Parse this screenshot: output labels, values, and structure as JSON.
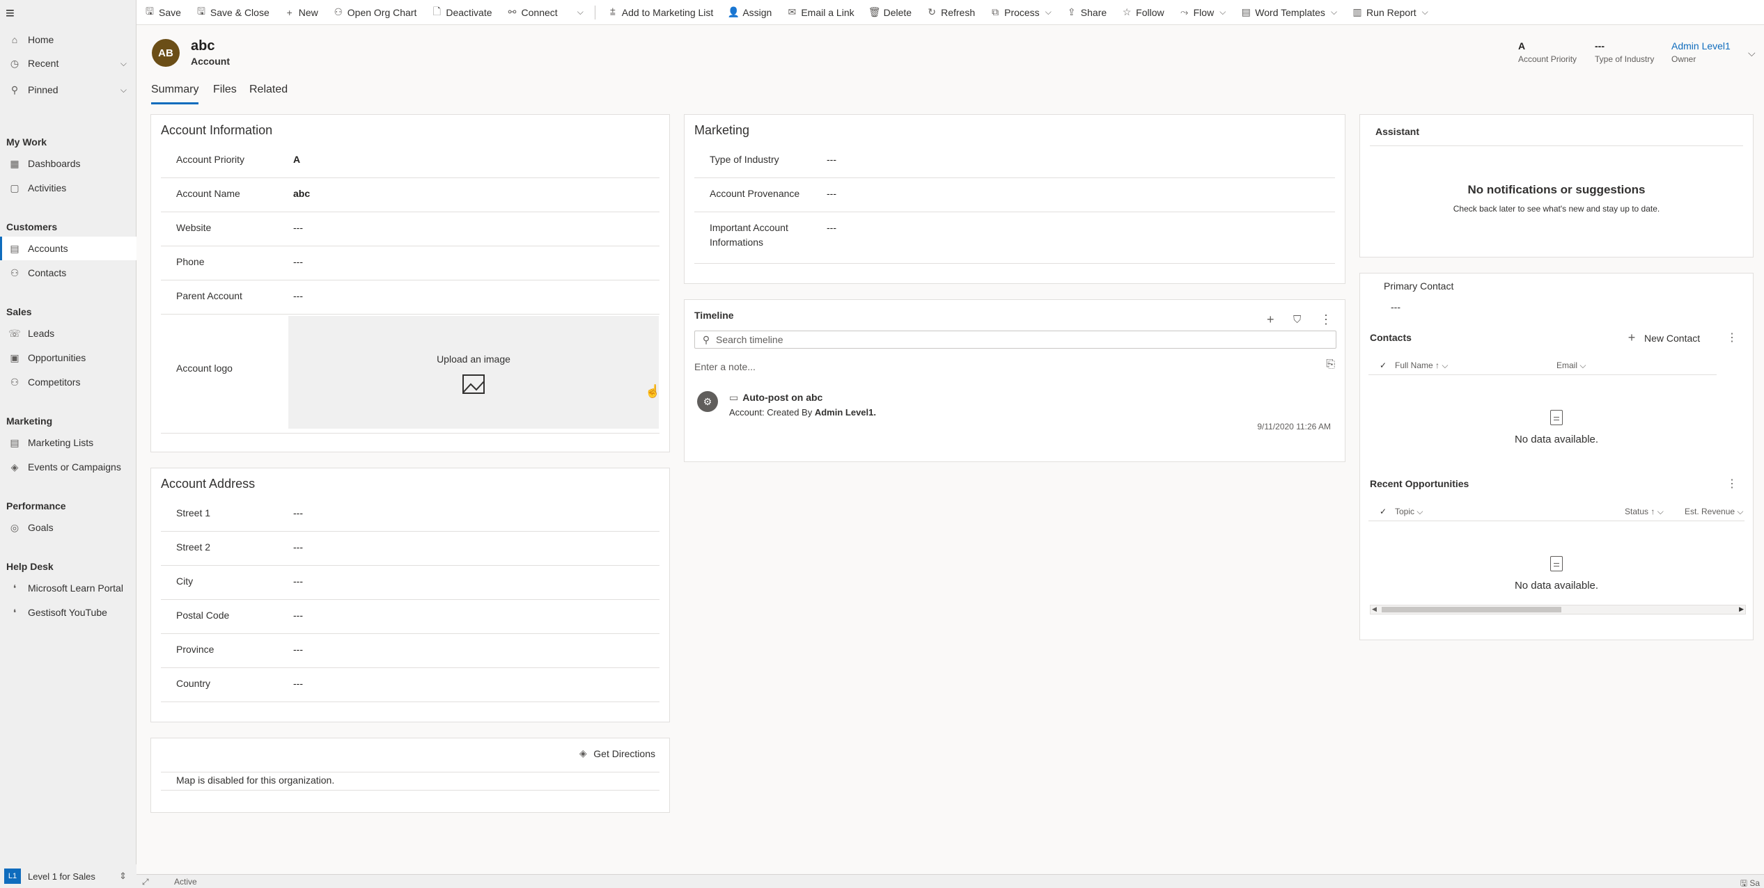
{
  "command_bar": {
    "items": [
      {
        "label": "Save",
        "icon": "save-icon",
        "glyph": "🖫"
      },
      {
        "label": "Save & Close",
        "icon": "save-close-icon",
        "glyph": "🖫"
      },
      {
        "label": "New",
        "icon": "plus-icon",
        "glyph": "+"
      },
      {
        "label": "Open Org Chart",
        "icon": "org-chart-icon",
        "glyph": "⚇"
      },
      {
        "label": "Deactivate",
        "icon": "deactivate-icon",
        "glyph": "🗋"
      },
      {
        "label": "Connect",
        "icon": "connect-icon",
        "glyph": "⚯"
      },
      {
        "label": "Add to Marketing List",
        "icon": "add-list-icon",
        "glyph": "⩲"
      },
      {
        "label": "Assign",
        "icon": "assign-icon",
        "glyph": "👤"
      },
      {
        "label": "Email a Link",
        "icon": "email-icon",
        "glyph": "✉"
      },
      {
        "label": "Delete",
        "icon": "delete-icon",
        "glyph": "🗑"
      },
      {
        "label": "Refresh",
        "icon": "refresh-icon",
        "glyph": "↻"
      },
      {
        "label": "Process",
        "icon": "process-icon",
        "glyph": "⧉"
      },
      {
        "label": "Share",
        "icon": "share-icon",
        "glyph": "⇪"
      },
      {
        "label": "Follow",
        "icon": "star-icon",
        "glyph": "☆"
      },
      {
        "label": "Flow",
        "icon": "flow-icon",
        "glyph": "⤳"
      },
      {
        "label": "Word Templates",
        "icon": "word-templates-icon",
        "glyph": "▤"
      },
      {
        "label": "Run Report",
        "icon": "report-icon",
        "glyph": "▥"
      }
    ]
  },
  "sidebar": {
    "top": [
      {
        "label": "Home",
        "icon": "home-icon",
        "glyph": "⌂"
      },
      {
        "label": "Recent",
        "icon": "clock-icon",
        "glyph": "◷",
        "chevron": "⌵"
      },
      {
        "label": "Pinned",
        "icon": "pin-icon",
        "glyph": "⚲",
        "chevron": "⌵"
      }
    ],
    "groups": [
      {
        "heading": "My Work",
        "items": [
          {
            "label": "Dashboards",
            "icon": "dashboard-icon",
            "glyph": "▦"
          },
          {
            "label": "Activities",
            "icon": "activities-icon",
            "glyph": "▢"
          }
        ]
      },
      {
        "heading": "Customers",
        "items": [
          {
            "label": "Accounts",
            "icon": "accounts-icon",
            "glyph": "▤",
            "selected": true
          },
          {
            "label": "Contacts",
            "icon": "contacts-icon",
            "glyph": "⚇"
          }
        ]
      },
      {
        "heading": "Sales",
        "items": [
          {
            "label": "Leads",
            "icon": "leads-icon",
            "glyph": "☏"
          },
          {
            "label": "Opportunities",
            "icon": "opportunities-icon",
            "glyph": "▣"
          },
          {
            "label": "Competitors",
            "icon": "competitors-icon",
            "glyph": "⚇"
          }
        ]
      },
      {
        "heading": "Marketing",
        "items": [
          {
            "label": "Marketing Lists",
            "icon": "marketing-lists-icon",
            "glyph": "▤"
          },
          {
            "label": "Events or Campaigns",
            "icon": "campaigns-icon",
            "glyph": "◈"
          }
        ]
      },
      {
        "heading": "Performance",
        "items": [
          {
            "label": "Goals",
            "icon": "goals-icon",
            "glyph": "◎"
          }
        ]
      },
      {
        "heading": "Help Desk",
        "items": [
          {
            "label": "Microsoft Learn Portal",
            "icon": "learn-portal-icon",
            "glyph": "❛"
          },
          {
            "label": "Gestisoft YouTube",
            "icon": "youtube-icon",
            "glyph": "❛"
          }
        ]
      }
    ],
    "area": {
      "badge": "L1",
      "label": "Level 1 for Sales"
    }
  },
  "header": {
    "initials": "AB",
    "title": "abc",
    "entity": "Account",
    "fields": [
      {
        "value": "A",
        "label": "Account Priority"
      },
      {
        "value": "---",
        "label": "Type of Industry"
      },
      {
        "value": "Admin Level1",
        "label": "Owner"
      }
    ]
  },
  "tabs": [
    "Summary",
    "Files",
    "Related"
  ],
  "account_info": {
    "title": "Account Information",
    "rows": [
      {
        "label": "Account Priority",
        "value": "A"
      },
      {
        "label": "Account Name",
        "value": "abc"
      },
      {
        "label": "Website",
        "value": "---"
      },
      {
        "label": "Phone",
        "value": "---"
      },
      {
        "label": "Parent Account",
        "value": "---"
      }
    ],
    "logo_label": "Account logo",
    "upload_text": "Upload an image"
  },
  "address": {
    "title": "Account Address",
    "rows": [
      {
        "label": "Street 1",
        "value": "---"
      },
      {
        "label": "Street 2",
        "value": "---"
      },
      {
        "label": "City",
        "value": "---"
      },
      {
        "label": "Postal Code",
        "value": "---"
      },
      {
        "label": "Province",
        "value": "---"
      },
      {
        "label": "Country",
        "value": "---"
      }
    ]
  },
  "map": {
    "directions": "Get Directions",
    "message": "Map is disabled for this organization."
  },
  "marketing": {
    "title": "Marketing",
    "rows": [
      {
        "label": "Type of Industry",
        "value": "---"
      },
      {
        "label": "Account Provenance",
        "value": "---"
      },
      {
        "label": "Important Account Informations",
        "value": "---"
      }
    ]
  },
  "timeline": {
    "title": "Timeline",
    "search_placeholder": "Search timeline",
    "note_placeholder": "Enter a note...",
    "post": {
      "title": "Auto-post on abc",
      "prefix": "Account: Created By ",
      "author": "Admin Level1.",
      "time": "9/11/2020 11:26 AM"
    }
  },
  "assistant": {
    "title": "Assistant",
    "heading": "No notifications or suggestions",
    "sub": "Check back later to see what's new and stay up to date."
  },
  "related": {
    "primary_contact_label": "Primary Contact",
    "primary_contact_value": "---",
    "contacts_title": "Contacts",
    "new_contact": "New Contact",
    "contacts_cols": [
      "Full Name",
      "Email"
    ],
    "no_data": "No data available.",
    "opps_title": "Recent Opportunities",
    "opps_cols": [
      "Topic",
      "Status",
      "Est. Revenue"
    ]
  },
  "status": {
    "state": "Active",
    "save": "Sa"
  }
}
